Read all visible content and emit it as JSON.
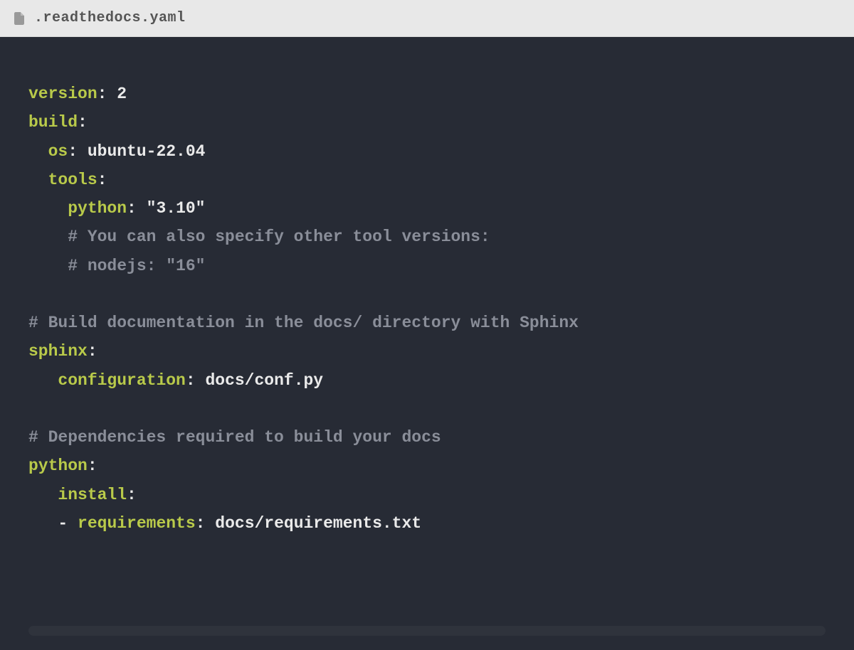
{
  "header": {
    "filename": ".readthedocs.yaml"
  },
  "code": {
    "lines": [
      {
        "segments": [
          {
            "cls": "key",
            "t": "version"
          },
          {
            "cls": "punct",
            "t": ":"
          },
          {
            "cls": "val",
            "t": " 2"
          }
        ]
      },
      {
        "segments": [
          {
            "cls": "key",
            "t": "build"
          },
          {
            "cls": "punct",
            "t": ":"
          }
        ]
      },
      {
        "segments": [
          {
            "cls": "val",
            "t": "  "
          },
          {
            "cls": "key",
            "t": "os"
          },
          {
            "cls": "punct",
            "t": ":"
          },
          {
            "cls": "val",
            "t": " ubuntu-22.04"
          }
        ]
      },
      {
        "segments": [
          {
            "cls": "val",
            "t": "  "
          },
          {
            "cls": "key",
            "t": "tools"
          },
          {
            "cls": "punct",
            "t": ":"
          }
        ]
      },
      {
        "segments": [
          {
            "cls": "val",
            "t": "    "
          },
          {
            "cls": "key",
            "t": "python"
          },
          {
            "cls": "punct",
            "t": ":"
          },
          {
            "cls": "val",
            "t": " "
          },
          {
            "cls": "str",
            "t": "\"3.10\""
          }
        ]
      },
      {
        "segments": [
          {
            "cls": "val",
            "t": "    "
          },
          {
            "cls": "comment",
            "t": "# You can also specify other tool versions:"
          }
        ]
      },
      {
        "segments": [
          {
            "cls": "val",
            "t": "    "
          },
          {
            "cls": "comment",
            "t": "# nodejs: \"16\""
          }
        ]
      },
      {
        "segments": [
          {
            "cls": "val",
            "t": " "
          }
        ]
      },
      {
        "segments": [
          {
            "cls": "comment",
            "t": "# Build documentation in the docs/ directory with Sphinx"
          }
        ]
      },
      {
        "segments": [
          {
            "cls": "key",
            "t": "sphinx"
          },
          {
            "cls": "punct",
            "t": ":"
          }
        ]
      },
      {
        "segments": [
          {
            "cls": "val",
            "t": "   "
          },
          {
            "cls": "key",
            "t": "configuration"
          },
          {
            "cls": "punct",
            "t": ":"
          },
          {
            "cls": "val",
            "t": " docs/conf.py"
          }
        ]
      },
      {
        "segments": [
          {
            "cls": "val",
            "t": " "
          }
        ]
      },
      {
        "segments": [
          {
            "cls": "comment",
            "t": "# Dependencies required to build your docs"
          }
        ]
      },
      {
        "segments": [
          {
            "cls": "key",
            "t": "python"
          },
          {
            "cls": "punct",
            "t": ":"
          }
        ]
      },
      {
        "segments": [
          {
            "cls": "val",
            "t": "   "
          },
          {
            "cls": "key",
            "t": "install"
          },
          {
            "cls": "punct",
            "t": ":"
          }
        ]
      },
      {
        "segments": [
          {
            "cls": "val",
            "t": "   "
          },
          {
            "cls": "dash",
            "t": "- "
          },
          {
            "cls": "key",
            "t": "requirements"
          },
          {
            "cls": "punct",
            "t": ":"
          },
          {
            "cls": "val",
            "t": " docs/requirements.txt"
          }
        ]
      }
    ]
  }
}
